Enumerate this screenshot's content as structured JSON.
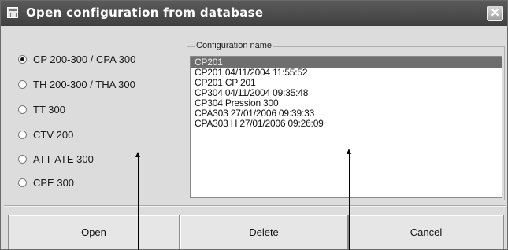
{
  "window": {
    "title": "Open configuration from database",
    "close_glyph": "✕"
  },
  "icons": [
    "app-icon",
    "close-icon"
  ],
  "radio_options": {
    "items": [
      {
        "label": "CP 200-300 / CPA 300",
        "checked": true
      },
      {
        "label": "TH 200-300 / THA 300",
        "checked": false
      },
      {
        "label": "TT 300",
        "checked": false
      },
      {
        "label": "CTV 200",
        "checked": false
      },
      {
        "label": "ATT-ATE 300",
        "checked": false
      },
      {
        "label": "CPE 300",
        "checked": false
      }
    ]
  },
  "configuration": {
    "legend": "Configuration name",
    "items": [
      "CP201",
      "CP201 04/11/2004 11:55:52",
      "CP201 CP 201",
      "CP304 04/11/2004 09:35:48",
      "CP304 Pression 300",
      "CPA303 27/01/2006 09:39:33",
      "CPA303 H 27/01/2006 09:26:09"
    ],
    "selected_index": 0
  },
  "buttons": {
    "open": "Open",
    "delete": "Delete",
    "cancel": "Cancel"
  }
}
